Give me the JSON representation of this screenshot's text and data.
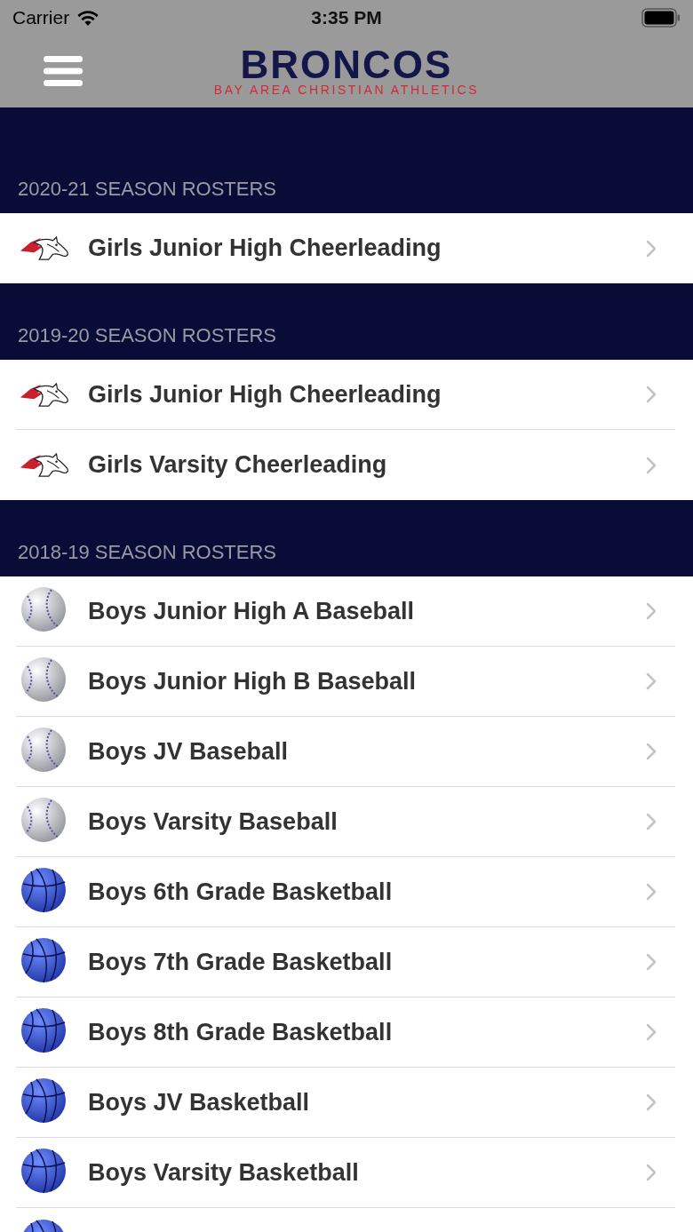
{
  "status_bar": {
    "carrier": "Carrier",
    "time": "3:35 PM"
  },
  "nav_bar": {
    "logo_title": "BRONCOS",
    "logo_subtitle": "BAY AREA CHRISTIAN ATHLETICS"
  },
  "sections": [
    {
      "title": "2020-21 SEASON ROSTERS",
      "items": [
        {
          "kind": "horse",
          "label": "Girls Junior High Cheerleading"
        }
      ]
    },
    {
      "title": "2019-20 SEASON ROSTERS",
      "items": [
        {
          "kind": "horse",
          "label": "Girls Junior High Cheerleading"
        },
        {
          "kind": "horse",
          "label": "Girls Varsity Cheerleading"
        }
      ]
    },
    {
      "title": "2018-19 SEASON ROSTERS",
      "items": [
        {
          "kind": "baseball",
          "label": "Boys Junior High A Baseball"
        },
        {
          "kind": "baseball",
          "label": "Boys Junior High B Baseball"
        },
        {
          "kind": "baseball",
          "label": "Boys JV Baseball"
        },
        {
          "kind": "baseball",
          "label": "Boys Varsity Baseball"
        },
        {
          "kind": "basketball",
          "label": "Boys 6th Grade Basketball"
        },
        {
          "kind": "basketball",
          "label": "Boys 7th Grade Basketball"
        },
        {
          "kind": "basketball",
          "label": "Boys 8th Grade Basketball"
        },
        {
          "kind": "basketball",
          "label": "Boys JV Basketball"
        },
        {
          "kind": "basketball",
          "label": "Boys Varsity Basketball"
        },
        {
          "kind": "basketball"
        }
      ]
    }
  ]
}
